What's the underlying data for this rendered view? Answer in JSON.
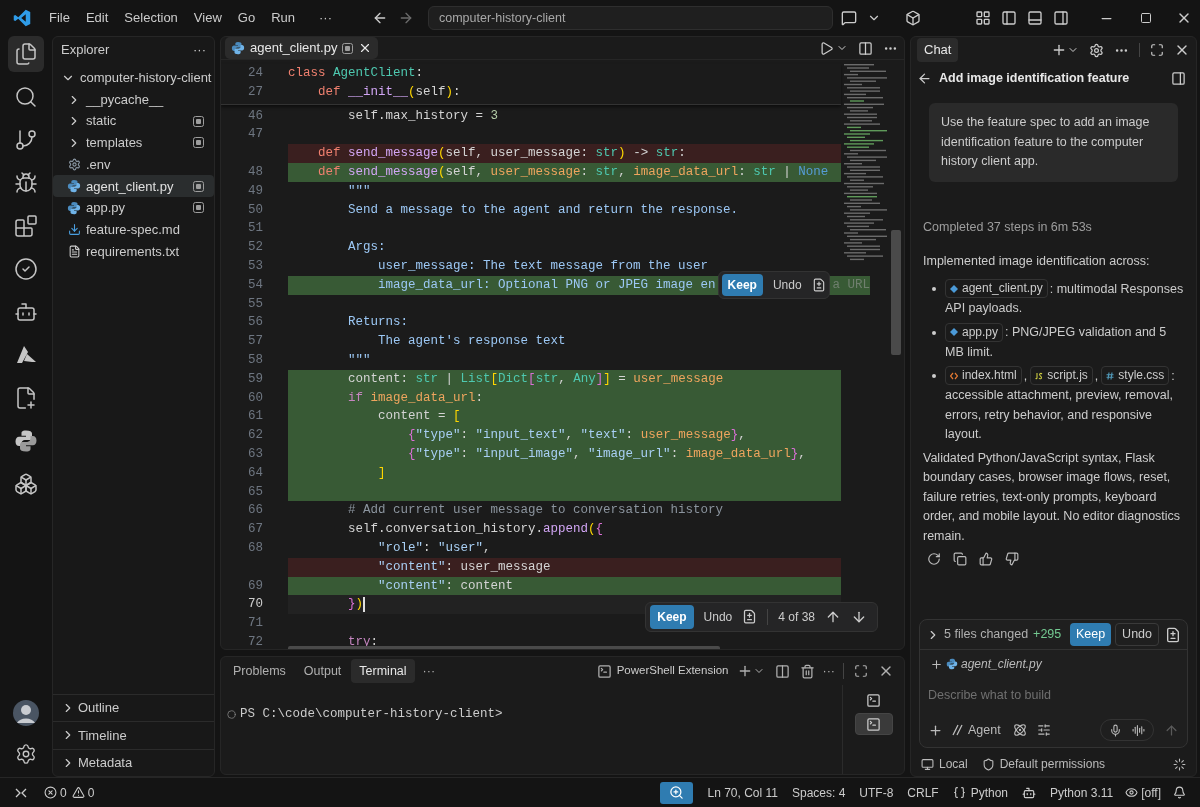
{
  "title_bar": {
    "menu": [
      "File",
      "Edit",
      "Selection",
      "View",
      "Go",
      "Run"
    ],
    "more": "···",
    "search": {
      "value": "computer-history-client"
    }
  },
  "activity_bar": {
    "items": [
      {
        "kind": "explorer",
        "selected": true
      },
      {
        "kind": "search",
        "selected": false
      },
      {
        "kind": "source-control",
        "selected": false
      },
      {
        "kind": "run-debug",
        "selected": false
      },
      {
        "kind": "extensions",
        "selected": false
      },
      {
        "kind": "testing",
        "selected": false
      },
      {
        "kind": "remote",
        "selected": false
      },
      {
        "kind": "azure",
        "selected": false
      },
      {
        "kind": "copilot",
        "selected": false
      },
      {
        "kind": "python",
        "selected": false
      },
      {
        "kind": "containers",
        "selected": false
      }
    ]
  },
  "sidebar": {
    "title": "Explorer",
    "more": "···",
    "tree": [
      {
        "label": "computer-history-client",
        "kind": "folder",
        "expanded": true,
        "selected": false,
        "modified": false,
        "children": [
          {
            "label": "__pycache__",
            "kind": "folder",
            "expanded": false,
            "selected": false,
            "modified": false
          },
          {
            "label": "static",
            "kind": "folder",
            "expanded": false,
            "selected": false,
            "modified": true
          },
          {
            "label": "templates",
            "kind": "folder",
            "expanded": false,
            "selected": false,
            "modified": true
          },
          {
            "label": ".env",
            "kind": "env",
            "selected": false,
            "modified": false
          },
          {
            "label": "agent_client.py",
            "kind": "python",
            "selected": true,
            "modified": true
          },
          {
            "label": "app.py",
            "kind": "python",
            "selected": false,
            "modified": true
          },
          {
            "label": "feature-spec.md",
            "kind": "markdown",
            "selected": false,
            "modified": false
          },
          {
            "label": "requirements.txt",
            "kind": "text",
            "selected": false,
            "modified": false
          }
        ]
      }
    ],
    "sections": [
      {
        "label": "Outline",
        "expanded": false
      },
      {
        "label": "Timeline",
        "expanded": false
      },
      {
        "label": "Metadata",
        "expanded": false
      }
    ]
  },
  "editor": {
    "tabs": [
      {
        "label": "agent_client.py",
        "selected": true,
        "modified": true
      }
    ],
    "sticky_lines": [
      {
        "number": "24",
        "tokens": [
          {
            "text": "class",
            "kind": "kw"
          },
          {
            "text": " AgentClient",
            "kind": "cls"
          },
          {
            "text": ":",
            "kind": "plain"
          }
        ]
      },
      {
        "number": "27",
        "tokens": [
          {
            "text": "    def",
            "kind": "kw"
          },
          {
            "text": " __init__",
            "kind": "fn"
          },
          {
            "text": "(",
            "kind": "br1"
          },
          {
            "text": "self",
            "kind": "plain"
          },
          {
            "text": ")",
            "kind": "br1"
          },
          {
            "text": ":",
            "kind": "plain"
          }
        ]
      }
    ],
    "lines": [
      {
        "number": "46",
        "kind": "normal",
        "tokens": [
          {
            "text": "        self.max_history = ",
            "kind": "plain"
          },
          {
            "text": "3",
            "kind": "num"
          }
        ]
      },
      {
        "number": "47",
        "kind": "normal"
      },
      {
        "kind": "removed",
        "tokens": [
          {
            "text": "    def",
            "kind": "kw"
          },
          {
            "text": " send_message",
            "kind": "fn"
          },
          {
            "text": "(",
            "kind": "br1"
          },
          {
            "text": "self, user_message: ",
            "kind": "plain"
          },
          {
            "text": "str",
            "kind": "type"
          },
          {
            "text": ")",
            "kind": "br1"
          },
          {
            "text": " -> ",
            "kind": "plain"
          },
          {
            "text": "str",
            "kind": "type"
          },
          {
            "text": ":",
            "kind": "plain"
          }
        ]
      },
      {
        "number": "48",
        "kind": "added",
        "tokens": [
          {
            "text": "    def",
            "kind": "kw"
          },
          {
            "text": " send_message",
            "kind": "fn"
          },
          {
            "text": "(",
            "kind": "br1"
          },
          {
            "text": "self, ",
            "kind": "plain"
          },
          {
            "text": "user_message",
            "kind": "param"
          },
          {
            "text": ": ",
            "kind": "plain"
          },
          {
            "text": "str",
            "kind": "type"
          },
          {
            "text": ", ",
            "kind": "plain"
          },
          {
            "text": "image_data_url",
            "kind": "param"
          },
          {
            "text": ": ",
            "kind": "plain"
          },
          {
            "text": "str",
            "kind": "type"
          },
          {
            "text": " | ",
            "kind": "plain"
          },
          {
            "text": "None",
            "kind": "const"
          }
        ]
      },
      {
        "number": "49",
        "kind": "normal",
        "tokens": [
          {
            "text": "        \"\"\"",
            "kind": "doc"
          }
        ]
      },
      {
        "number": "50",
        "kind": "normal",
        "tokens": [
          {
            "text": "        Send a message to the agent and return the response.",
            "kind": "doc"
          }
        ]
      },
      {
        "number": "51",
        "kind": "normal"
      },
      {
        "number": "52",
        "kind": "normal",
        "tokens": [
          {
            "text": "        Args:",
            "kind": "doc"
          }
        ]
      },
      {
        "number": "53",
        "kind": "normal",
        "tokens": [
          {
            "text": "            user_message: The text message from the user",
            "kind": "doc"
          }
        ]
      },
      {
        "number": "54",
        "kind": "added",
        "tokens": [
          {
            "text": "            image_data_url: Optional PNG or JPEG image en",
            "kind": "doc"
          }
        ],
        "review": {
          "keep": "Keep",
          "undo": "Undo"
        },
        "tail_tokens": [
          {
            "text": "a URL",
            "kind": "faded"
          }
        ]
      },
      {
        "number": "55",
        "kind": "normal"
      },
      {
        "number": "56",
        "kind": "normal",
        "tokens": [
          {
            "text": "        Returns:",
            "kind": "doc"
          }
        ]
      },
      {
        "number": "57",
        "kind": "normal",
        "tokens": [
          {
            "text": "            The agent's response text",
            "kind": "doc"
          }
        ]
      },
      {
        "number": "58",
        "kind": "normal",
        "tokens": [
          {
            "text": "        \"\"\"",
            "kind": "doc"
          }
        ]
      },
      {
        "number": "59",
        "kind": "added",
        "tokens": [
          {
            "text": "        content: ",
            "kind": "plain"
          },
          {
            "text": "str",
            "kind": "type"
          },
          {
            "text": " | ",
            "kind": "plain"
          },
          {
            "text": "List",
            "kind": "type"
          },
          {
            "text": "[",
            "kind": "br1"
          },
          {
            "text": "Dict",
            "kind": "type"
          },
          {
            "text": "[",
            "kind": "br2"
          },
          {
            "text": "str",
            "kind": "type"
          },
          {
            "text": ", ",
            "kind": "plain"
          },
          {
            "text": "Any",
            "kind": "type"
          },
          {
            "text": "]",
            "kind": "br2"
          },
          {
            "text": "]",
            "kind": "br1"
          },
          {
            "text": " = ",
            "kind": "plain"
          },
          {
            "text": "user_message",
            "kind": "param"
          }
        ]
      },
      {
        "number": "60",
        "kind": "added",
        "tokens": [
          {
            "text": "        if",
            "kind": "ctrl"
          },
          {
            "text": " image_data_url",
            "kind": "param"
          },
          {
            "text": ":",
            "kind": "plain"
          }
        ]
      },
      {
        "number": "61",
        "kind": "added",
        "tokens": [
          {
            "text": "            content = ",
            "kind": "plain"
          },
          {
            "text": "[",
            "kind": "br1"
          }
        ]
      },
      {
        "number": "62",
        "kind": "added",
        "tokens": [
          {
            "text": "                {",
            "kind": "br2"
          },
          {
            "text": "\"type\"",
            "kind": "str"
          },
          {
            "text": ": ",
            "kind": "plain"
          },
          {
            "text": "\"input_text\"",
            "kind": "str"
          },
          {
            "text": ", ",
            "kind": "plain"
          },
          {
            "text": "\"text\"",
            "kind": "str"
          },
          {
            "text": ": ",
            "kind": "plain"
          },
          {
            "text": "user_message",
            "kind": "param"
          },
          {
            "text": "}",
            "kind": "br2"
          },
          {
            "text": ",",
            "kind": "plain"
          }
        ]
      },
      {
        "number": "63",
        "kind": "added",
        "tokens": [
          {
            "text": "                {",
            "kind": "br2"
          },
          {
            "text": "\"type\"",
            "kind": "str"
          },
          {
            "text": ": ",
            "kind": "plain"
          },
          {
            "text": "\"input_image\"",
            "kind": "str"
          },
          {
            "text": ", ",
            "kind": "plain"
          },
          {
            "text": "\"image_url\"",
            "kind": "str"
          },
          {
            "text": ": ",
            "kind": "plain"
          },
          {
            "text": "image_data_url",
            "kind": "param"
          },
          {
            "text": "}",
            "kind": "br2"
          },
          {
            "text": ",",
            "kind": "plain"
          }
        ]
      },
      {
        "number": "64",
        "kind": "added",
        "tokens": [
          {
            "text": "            ]",
            "kind": "br1"
          }
        ]
      },
      {
        "number": "65",
        "kind": "added"
      },
      {
        "number": "66",
        "kind": "normal",
        "tokens": [
          {
            "text": "        # Add current user message to conversation history",
            "kind": "comment"
          }
        ]
      },
      {
        "number": "67",
        "kind": "normal",
        "tokens": [
          {
            "text": "        self.conversation_history.",
            "kind": "plain"
          },
          {
            "text": "append",
            "kind": "fn"
          },
          {
            "text": "(",
            "kind": "br1"
          },
          {
            "text": "{",
            "kind": "br2"
          }
        ]
      },
      {
        "number": "68",
        "kind": "normal",
        "tokens": [
          {
            "text": "            \"role\"",
            "kind": "str"
          },
          {
            "text": ": ",
            "kind": "plain"
          },
          {
            "text": "\"user\"",
            "kind": "str"
          },
          {
            "text": ",",
            "kind": "plain"
          }
        ]
      },
      {
        "kind": "removed",
        "tokens": [
          {
            "text": "            \"content\"",
            "kind": "str"
          },
          {
            "text": ": ",
            "kind": "plain"
          },
          {
            "text": "user_message",
            "kind": "plain"
          }
        ]
      },
      {
        "number": "69",
        "kind": "added",
        "tokens": [
          {
            "text": "            \"content\"",
            "kind": "str"
          },
          {
            "text": ": ",
            "kind": "plain"
          },
          {
            "text": "content",
            "kind": "plain"
          }
        ]
      },
      {
        "number": "70",
        "kind": "current",
        "tokens": [
          {
            "text": "        }",
            "kind": "br2"
          },
          {
            "text": ")",
            "kind": "br1"
          }
        ]
      },
      {
        "number": "71",
        "kind": "normal"
      },
      {
        "number": "72",
        "kind": "normal",
        "tokens": [
          {
            "text": "        try",
            "kind": "ctrl"
          },
          {
            "text": ":",
            "kind": "plain"
          }
        ]
      }
    ],
    "review_bar": {
      "keep": "Keep",
      "undo": "Undo",
      "position": "4 of 38"
    }
  },
  "panel": {
    "tabs": [
      {
        "label": "Problems",
        "selected": false
      },
      {
        "label": "Output",
        "selected": false
      },
      {
        "label": "Terminal",
        "selected": true
      }
    ],
    "more": "···",
    "terminal_name": "PowerShell Extension",
    "actions_more": "···",
    "terminal_lines": [
      "PS C:\\code\\computer-history-client>"
    ],
    "terminals": [
      {
        "selected": false
      },
      {
        "selected": true
      }
    ]
  },
  "chat": {
    "tab": "Chat",
    "title": "Add image identification feature",
    "request": "Use the feature spec to add an image identification feature to the computer history client app.",
    "status": "Completed 37 steps in 6m 53s",
    "intro": "Implemented image identification across:",
    "bullets": [
      {
        "parts": [
          {
            "kind": "python",
            "text": "agent_client.py"
          },
          {
            "kind": "text",
            "text": ": multimodal Responses API payloads."
          }
        ]
      },
      {
        "parts": [
          {
            "kind": "python",
            "text": "app.py"
          },
          {
            "kind": "text",
            "text": ": PNG/JPEG validation and 5 MB limit."
          }
        ]
      },
      {
        "parts": [
          {
            "kind": "html",
            "text": "index.html"
          },
          {
            "kind": "text",
            "text": ","
          },
          {
            "kind": "js",
            "text": "script.js"
          },
          {
            "kind": "text",
            "text": ","
          },
          {
            "kind": "css",
            "text": "style.css"
          },
          {
            "kind": "text",
            "text": ": accessible attachment, preview, removal, errors, retry behavior, and responsive layout."
          }
        ]
      }
    ],
    "summary": "Validated Python/JavaScript syntax, Flask boundary cases, browser image flows, reset, failure retries, text-only prompts, keyboard order, and mobile layout. No editor diagnostics remain.",
    "changes": {
      "label": "5 files changed",
      "added": "+295",
      "keep": "Keep",
      "undo": "Undo"
    },
    "attachment": "agent_client.py",
    "input": {
      "placeholder": "Describe what to build"
    },
    "mode": "Agent",
    "location": "Local",
    "permissions": "Default permissions"
  },
  "status_bar": {
    "errors": "0",
    "warnings": "0",
    "items": [
      "Ln 70, Col 11",
      "Spaces: 4",
      "UTF-8",
      "CRLF"
    ],
    "language": "Python",
    "interpreter": "Python 3.11",
    "preview": "[off]"
  }
}
